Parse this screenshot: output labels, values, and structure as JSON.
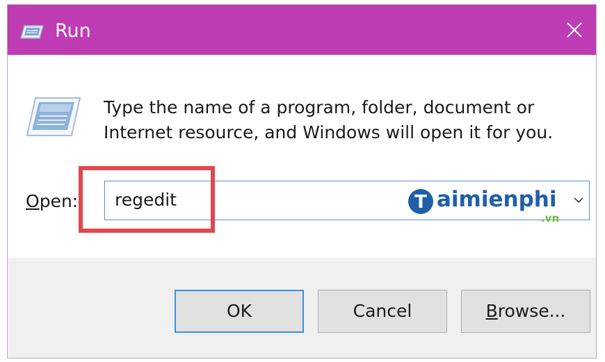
{
  "window": {
    "title": "Run",
    "titlebar_color": "#bf3cb4"
  },
  "dialog": {
    "description_line1": "Type the name of a program, folder, document or",
    "description_line2": "Internet resource, and Windows will open it for you.",
    "open_label_mnemonic": "O",
    "open_label_rest": "pen:",
    "open_value": "regedit"
  },
  "watermark": {
    "logo_letter": "T",
    "text": "aimienphi",
    "domain": ".vn"
  },
  "buttons": {
    "ok_label": "OK",
    "cancel_label": "Cancel",
    "browse_mnemonic": "B",
    "browse_rest": "rowse..."
  },
  "annotation": {
    "highlight_color": "#e0484f"
  },
  "icons": {
    "title": "run-icon",
    "close": "close-icon",
    "dropdown": "chevron-down-icon"
  }
}
